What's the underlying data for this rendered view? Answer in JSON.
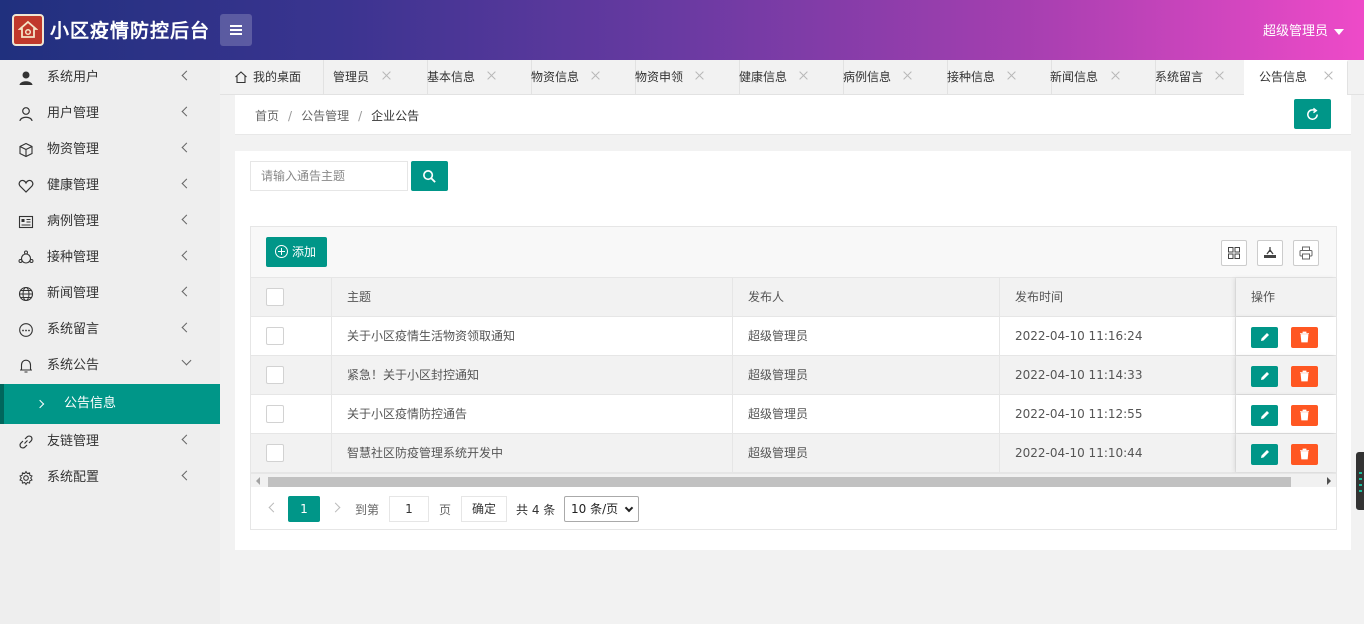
{
  "header": {
    "app_title": "小区疫情防控后台",
    "user_name": "超级管理员"
  },
  "sidebar": {
    "items": [
      {
        "label": "系统用户",
        "icon": "user-solid-icon"
      },
      {
        "label": "用户管理",
        "icon": "user-outline-icon"
      },
      {
        "label": "物资管理",
        "icon": "cube-icon"
      },
      {
        "label": "健康管理",
        "icon": "heart-icon"
      },
      {
        "label": "病例管理",
        "icon": "id-card-icon"
      },
      {
        "label": "接种管理",
        "icon": "vaccine-icon"
      },
      {
        "label": "新闻管理",
        "icon": "globe-icon"
      },
      {
        "label": "系统留言",
        "icon": "comment-icon"
      },
      {
        "label": "系统公告",
        "icon": "bell-icon"
      },
      {
        "label": "友链管理",
        "icon": "link-icon"
      },
      {
        "label": "系统配置",
        "icon": "gear-icon"
      }
    ],
    "sub_item": {
      "label": "公告信息"
    }
  },
  "tabs": [
    {
      "label": "我的桌面"
    },
    {
      "label": "管理员"
    },
    {
      "label": "基本信息"
    },
    {
      "label": "物资信息"
    },
    {
      "label": "物资申领"
    },
    {
      "label": "健康信息"
    },
    {
      "label": "病例信息"
    },
    {
      "label": "接种信息"
    },
    {
      "label": "新闻信息"
    },
    {
      "label": "系统留言"
    },
    {
      "label": "公告信息",
      "active": true
    }
  ],
  "breadcrumb": [
    "首页",
    "公告管理",
    "企业公告"
  ],
  "search": {
    "placeholder": "请输入通告主题"
  },
  "toolbar": {
    "add_label": "添加"
  },
  "table": {
    "columns": [
      "主题",
      "发布人",
      "发布时间",
      "操作"
    ],
    "rows": [
      {
        "title": "关于小区疫情生活物资领取通知",
        "publisher": "超级管理员",
        "time": "2022-04-10 11:16:24"
      },
      {
        "title": "紧急！关于小区封控通知",
        "publisher": "超级管理员",
        "time": "2022-04-10 11:14:33"
      },
      {
        "title": "关于小区疫情防控通告",
        "publisher": "超级管理员",
        "time": "2022-04-10 11:12:55"
      },
      {
        "title": "智慧社区防疫管理系统开发中",
        "publisher": "超级管理员",
        "time": "2022-04-10 11:10:44"
      }
    ]
  },
  "pager": {
    "current_page": "1",
    "goto_label": "到第",
    "goto_value": "1",
    "page_label": "页",
    "confirm_label": "确定",
    "total_label": "共 4 条",
    "page_size": "10 条/页"
  },
  "colors": {
    "primary": "#009688",
    "danger": "#ff5722"
  }
}
